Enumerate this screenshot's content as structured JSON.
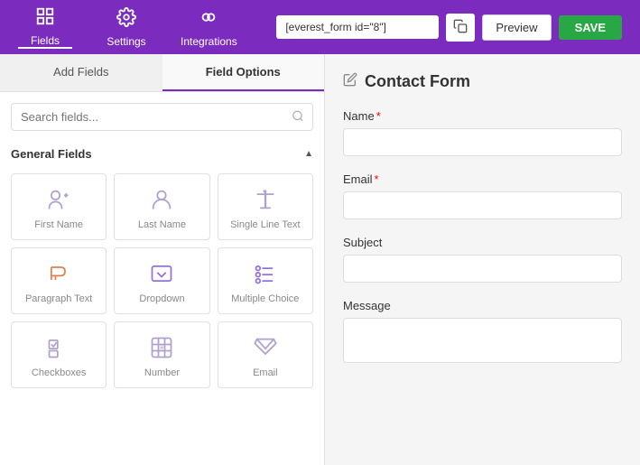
{
  "header": {
    "nav_items": [
      {
        "id": "fields",
        "label": "Fields",
        "active": true
      },
      {
        "id": "settings",
        "label": "Settings",
        "active": false
      },
      {
        "id": "integrations",
        "label": "Integrations",
        "active": false
      }
    ],
    "shortcode": "[everest_form id=\"8\"]",
    "preview_label": "Preview",
    "save_label": "SAVE"
  },
  "left_panel": {
    "tab_add_fields": "Add Fields",
    "tab_field_options": "Field Options",
    "search_placeholder": "Search fields...",
    "section_general": "General Fields",
    "fields": [
      {
        "id": "first-name",
        "label": "First Name",
        "icon_type": "first-name"
      },
      {
        "id": "last-name",
        "label": "Last Name",
        "icon_type": "last-name"
      },
      {
        "id": "single-line",
        "label": "Single Line Text",
        "icon_type": "text"
      },
      {
        "id": "paragraph",
        "label": "Paragraph Text",
        "icon_type": "paragraph"
      },
      {
        "id": "dropdown",
        "label": "Dropdown",
        "icon_type": "dropdown"
      },
      {
        "id": "multiple-choice",
        "label": "Multiple Choice",
        "icon_type": "multiple-choice"
      },
      {
        "id": "checkboxes",
        "label": "Checkboxes",
        "icon_type": "checkboxes"
      },
      {
        "id": "number",
        "label": "Number",
        "icon_type": "number"
      },
      {
        "id": "email",
        "label": "Email",
        "icon_type": "email"
      }
    ]
  },
  "right_panel": {
    "form_title": "Contact Form",
    "fields": [
      {
        "id": "name",
        "label": "Name",
        "required": true,
        "type": "input"
      },
      {
        "id": "email",
        "label": "Email",
        "required": true,
        "type": "input"
      },
      {
        "id": "subject",
        "label": "Subject",
        "required": false,
        "type": "input"
      },
      {
        "id": "message",
        "label": "Message",
        "required": false,
        "type": "textarea"
      }
    ]
  }
}
